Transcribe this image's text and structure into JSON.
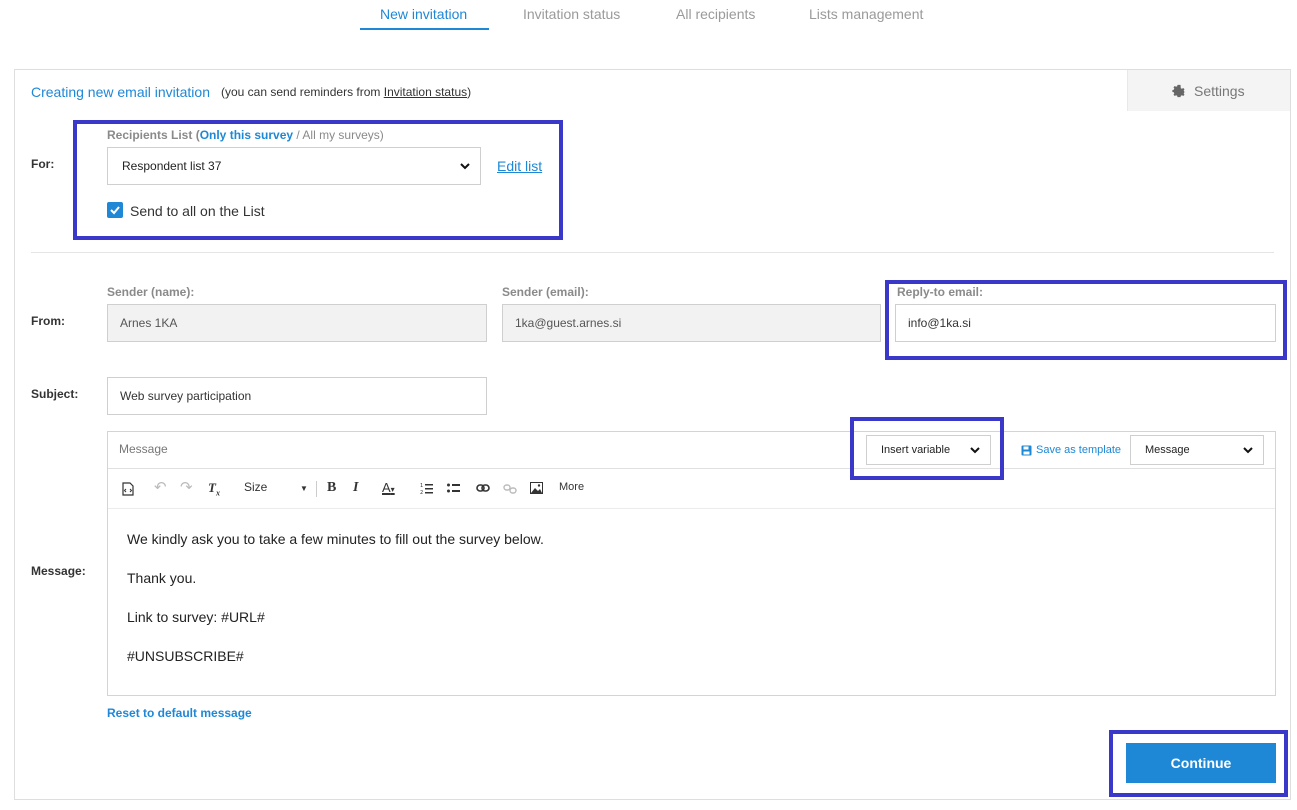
{
  "tabs": [
    {
      "label": "New invitation",
      "active": true
    },
    {
      "label": "Invitation status",
      "active": false
    },
    {
      "label": "All recipients",
      "active": false
    },
    {
      "label": "Lists management",
      "active": false
    }
  ],
  "header": {
    "title": "Creating new email invitation",
    "note_prefix": "(you can send reminders from ",
    "note_link": "Invitation status",
    "note_suffix": ")",
    "settings_label": "Settings"
  },
  "for_section": {
    "label": "For:",
    "recipients_prefix": "Recipients List (",
    "recipients_only": "Only this survey",
    "recipients_sep": " / ",
    "recipients_all": "All my surveys)",
    "selected_list": "Respondent list 37",
    "edit_list": "Edit list",
    "send_all_label": "Send to all on the List",
    "send_all_checked": true
  },
  "from_section": {
    "label": "From:",
    "sender_name_label": "Sender (name):",
    "sender_name_value": "Arnes 1KA",
    "sender_email_label": "Sender (email):",
    "sender_email_value": "1ka@guest.arnes.si",
    "reply_to_label": "Reply-to email:",
    "reply_to_value": "info@1ka.si"
  },
  "subject": {
    "label": "Subject:",
    "value": "Web survey participation"
  },
  "message": {
    "label": "Message:",
    "editor_title": "Message",
    "insert_variable": "Insert variable",
    "save_as_template": "Save as template",
    "template_select": "Message",
    "toolbar": {
      "size": "Size",
      "more": "More"
    },
    "lines": [
      "We kindly ask you to take a few minutes to fill out the survey below.",
      "Thank you.",
      "Link to survey: #URL#",
      "#UNSUBSCRIBE#"
    ],
    "reset_link": "Reset to default message"
  },
  "actions": {
    "continue": "Continue"
  },
  "colors": {
    "accent": "#1e88d6",
    "highlight": "#3a38c8"
  }
}
